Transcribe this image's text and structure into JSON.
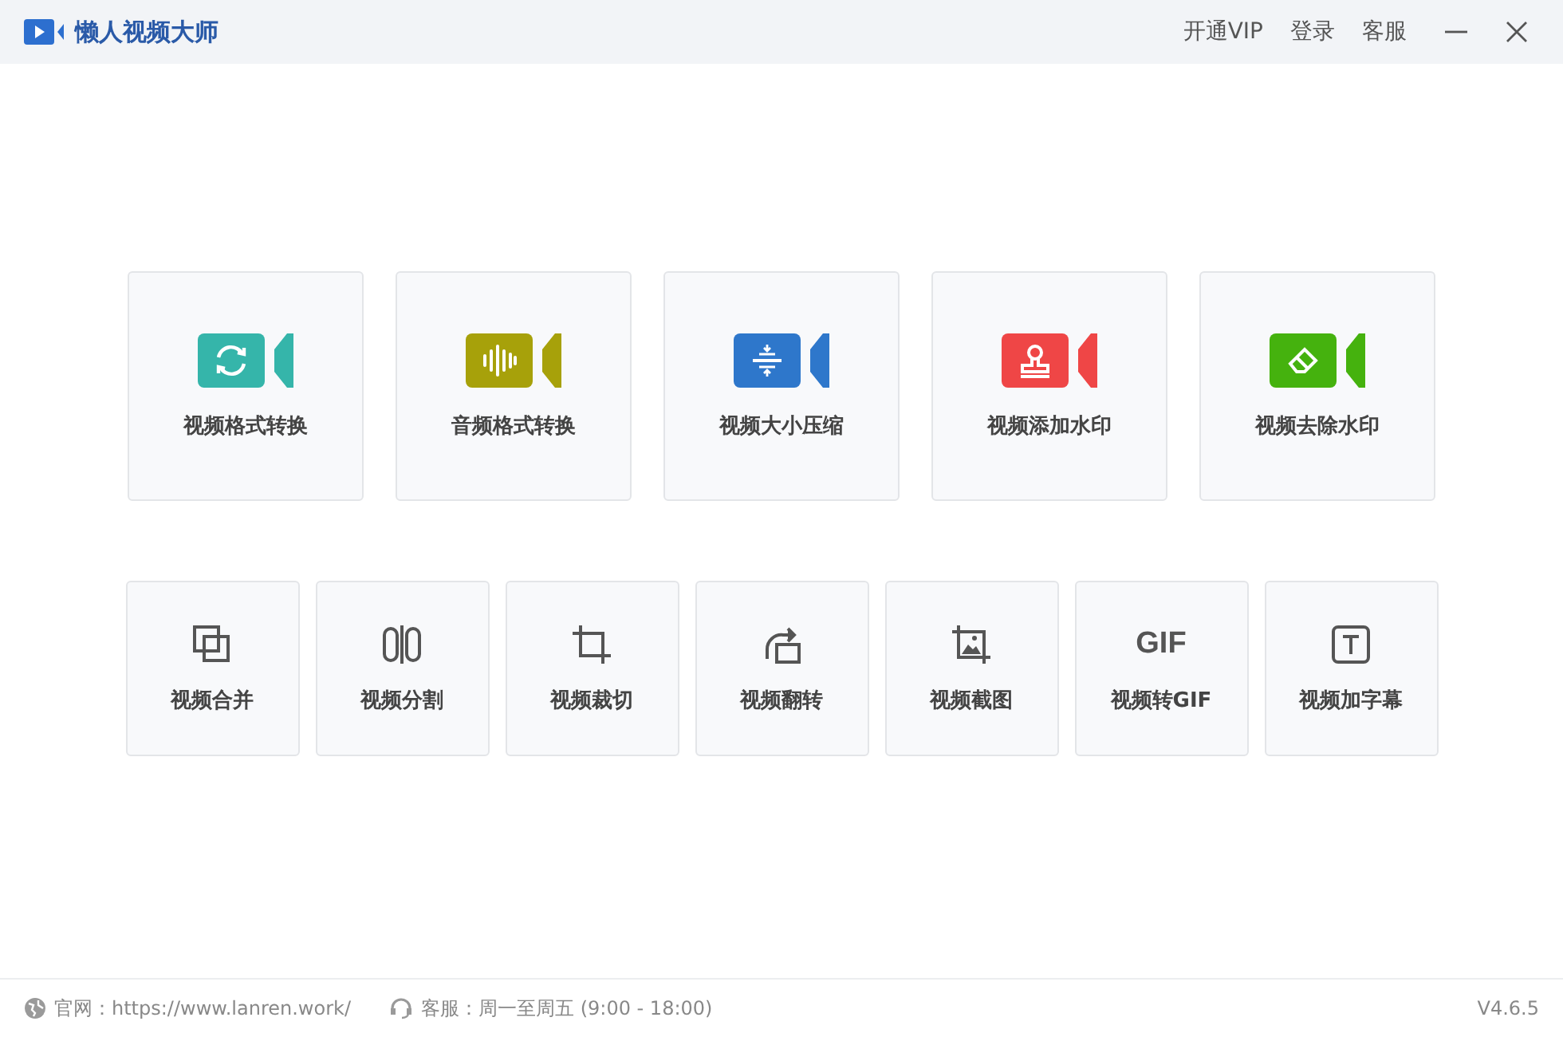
{
  "window": {
    "title": "懒人视频大师"
  },
  "header_links": [
    "开通VIP",
    "登录",
    "客服"
  ],
  "main_tools": [
    {
      "label": "视频格式转换",
      "kind": "convert",
      "color": "#35b5aa"
    },
    {
      "label": "音频格式转换",
      "kind": "audio",
      "color": "#a7a10a"
    },
    {
      "label": "视频大小压缩",
      "kind": "compress",
      "color": "#2e77cb"
    },
    {
      "label": "视频添加水印",
      "kind": "stamp",
      "color": "#ef4646"
    },
    {
      "label": "视频去除水印",
      "kind": "eraser",
      "color": "#45b20e"
    }
  ],
  "small_tools": [
    {
      "label": "视频合并",
      "kind": "merge"
    },
    {
      "label": "视频分割",
      "kind": "split"
    },
    {
      "label": "视频裁切",
      "kind": "crop"
    },
    {
      "label": "视频翻转",
      "kind": "rotate"
    },
    {
      "label": "视频截图",
      "kind": "screenshot"
    },
    {
      "label": "视频转GIF",
      "kind": "text",
      "glyph": "GIF"
    },
    {
      "label": "视频加字幕",
      "kind": "subtitle"
    }
  ],
  "status_bar": {
    "website": "官网：https://www.lanren.work/",
    "support": "客服：周一至周五 (9:00 - 18:00)",
    "version": "V4.6.5"
  }
}
